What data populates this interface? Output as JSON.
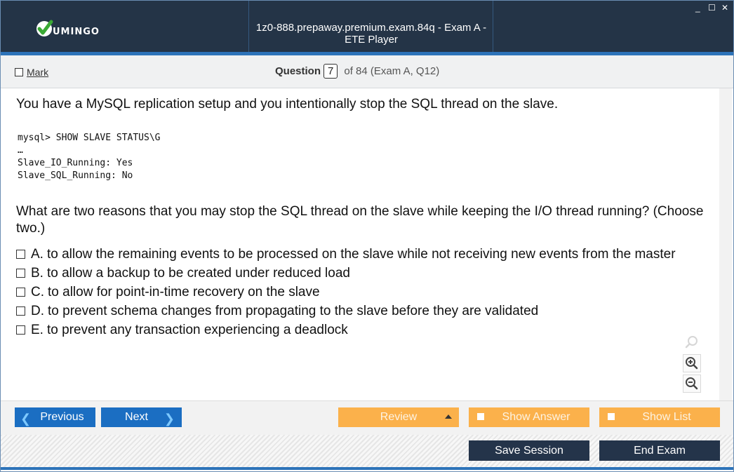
{
  "window": {
    "title": "1z0-888.prepaway.premium.exam.84q - Exam A - ETE Player",
    "logo_text": "UMINGO",
    "controls": [
      "_",
      "☐",
      "✕"
    ]
  },
  "header": {
    "mark_label": "Mark",
    "question_label": "Question",
    "question_number": "7",
    "question_total": "of 84 (Exam A, Q12)"
  },
  "question": {
    "stem": "You have a MySQL replication setup and you intentionally stop the SQL thread on the slave.",
    "code_lines": [
      "mysql> SHOW SLAVE STATUS\\G",
      "…",
      "Slave_IO_Running: Yes",
      "Slave_SQL_Running: No"
    ],
    "prompt": "What are two reasons that you may stop the SQL thread on the slave while keeping the I/O thread running? (Choose two.)",
    "options": [
      {
        "letter": "A.",
        "text": "to allow the remaining events to be processed on the slave while not receiving new events from the master"
      },
      {
        "letter": "B.",
        "text": "to allow a backup to be created under reduced load"
      },
      {
        "letter": "C.",
        "text": "to allow for point-in-time recovery on the slave"
      },
      {
        "letter": "D.",
        "text": "to prevent schema changes from propagating to the slave before they are validated"
      },
      {
        "letter": "E.",
        "text": "to prevent any transaction experiencing a deadlock"
      }
    ]
  },
  "nav": {
    "previous": "Previous",
    "next": "Next",
    "review": "Review",
    "show_answer": "Show Answer",
    "show_list": "Show List"
  },
  "footer": {
    "save_session": "Save Session",
    "end_exam": "End Exam"
  },
  "icons": {
    "zoom_reset": "search-icon",
    "zoom_in": "zoom-in-icon",
    "zoom_out": "zoom-out-icon"
  },
  "colors": {
    "titlebar": "#243447",
    "accent_blue": "#1b6ec2",
    "orange": "#fbb14b",
    "dark_button": "#24344a"
  }
}
